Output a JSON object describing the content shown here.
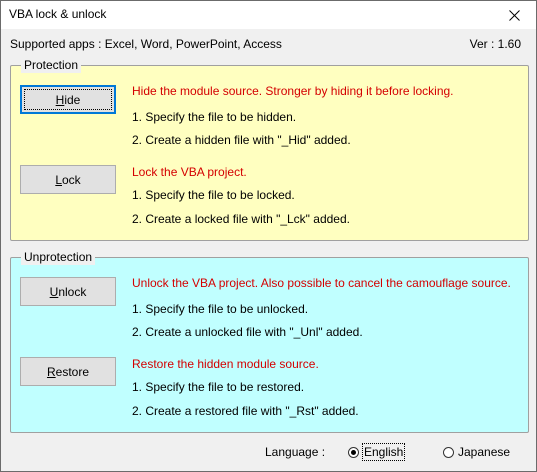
{
  "window": {
    "title": "VBA lock & unlock",
    "close_glyph": "✕"
  },
  "info": {
    "supported_apps": "Supported apps : Excel, Word, PowerPoint, Access",
    "version": "Ver : 1.60"
  },
  "protection": {
    "legend": "Protection",
    "hide": {
      "button_label": "Hide",
      "button_accesskey": "H",
      "button_rest": "ide",
      "description": "Hide the module source. Stronger by hiding it before locking.",
      "step1": "1. Specify the file to be hidden.",
      "step2": "2. Create a hidden file with \"_Hid\" added."
    },
    "lock": {
      "button_label": "Lock",
      "button_accesskey": "L",
      "button_rest": "ock",
      "description": "Lock the VBA project.",
      "step1": "1. Specify the file to be locked.",
      "step2": "2. Create a locked file with \"_Lck\" added."
    }
  },
  "unprotection": {
    "legend": "Unprotection",
    "unlock": {
      "button_label": "Unlock",
      "button_accesskey": "U",
      "button_rest": "nlock",
      "description": "Unlock the VBA project. Also possible to cancel the camouflage source.",
      "step1": "1. Specify the file to be unlocked.",
      "step2": "2. Create a unlocked file with \"_Unl\" added."
    },
    "restore": {
      "button_label": "Restore",
      "button_accesskey": "R",
      "button_rest": "estore",
      "description": "Restore the hidden module source.",
      "step1": "1. Specify the file to be restored.",
      "step2": "2. Create a restored file with \"_Rst\" added."
    }
  },
  "language": {
    "label": "Language :",
    "options": [
      "English",
      "Japanese"
    ],
    "selected": "English"
  },
  "colors": {
    "protection_bg": "#ffffc0",
    "unprotection_bg": "#c0ffff",
    "description_text": "#d40000",
    "focus_border": "#0078d7"
  }
}
